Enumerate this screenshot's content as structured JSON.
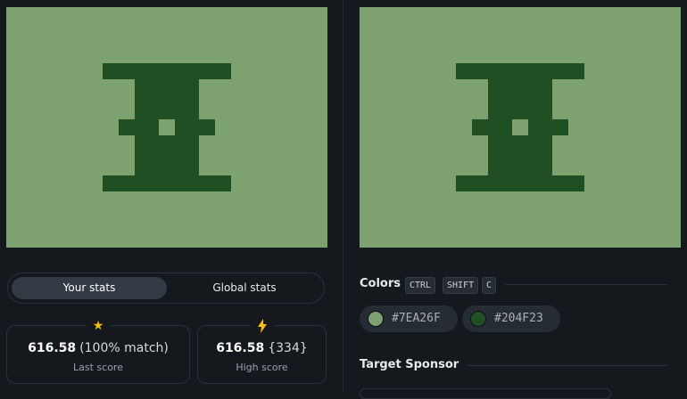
{
  "stats_tabs": {
    "your_stats": "Your stats",
    "global_stats": "Global stats"
  },
  "last_score": {
    "value": "616.58",
    "detail": "(100% match)",
    "caption": "Last score",
    "icon": "star-icon"
  },
  "high_score": {
    "value": "616.58",
    "detail": "{334}",
    "caption": "High score",
    "icon": "lightning-icon"
  },
  "colors_section": {
    "title": "Colors",
    "shortcut": [
      "CTRL",
      "SHIFT",
      "C"
    ],
    "swatches": [
      {
        "hex": "#7EA26F",
        "color": "#7ea26f"
      },
      {
        "hex": "#204F23",
        "color": "#204f23"
      }
    ]
  },
  "sponsor_section": {
    "title": "Target Sponsor"
  }
}
